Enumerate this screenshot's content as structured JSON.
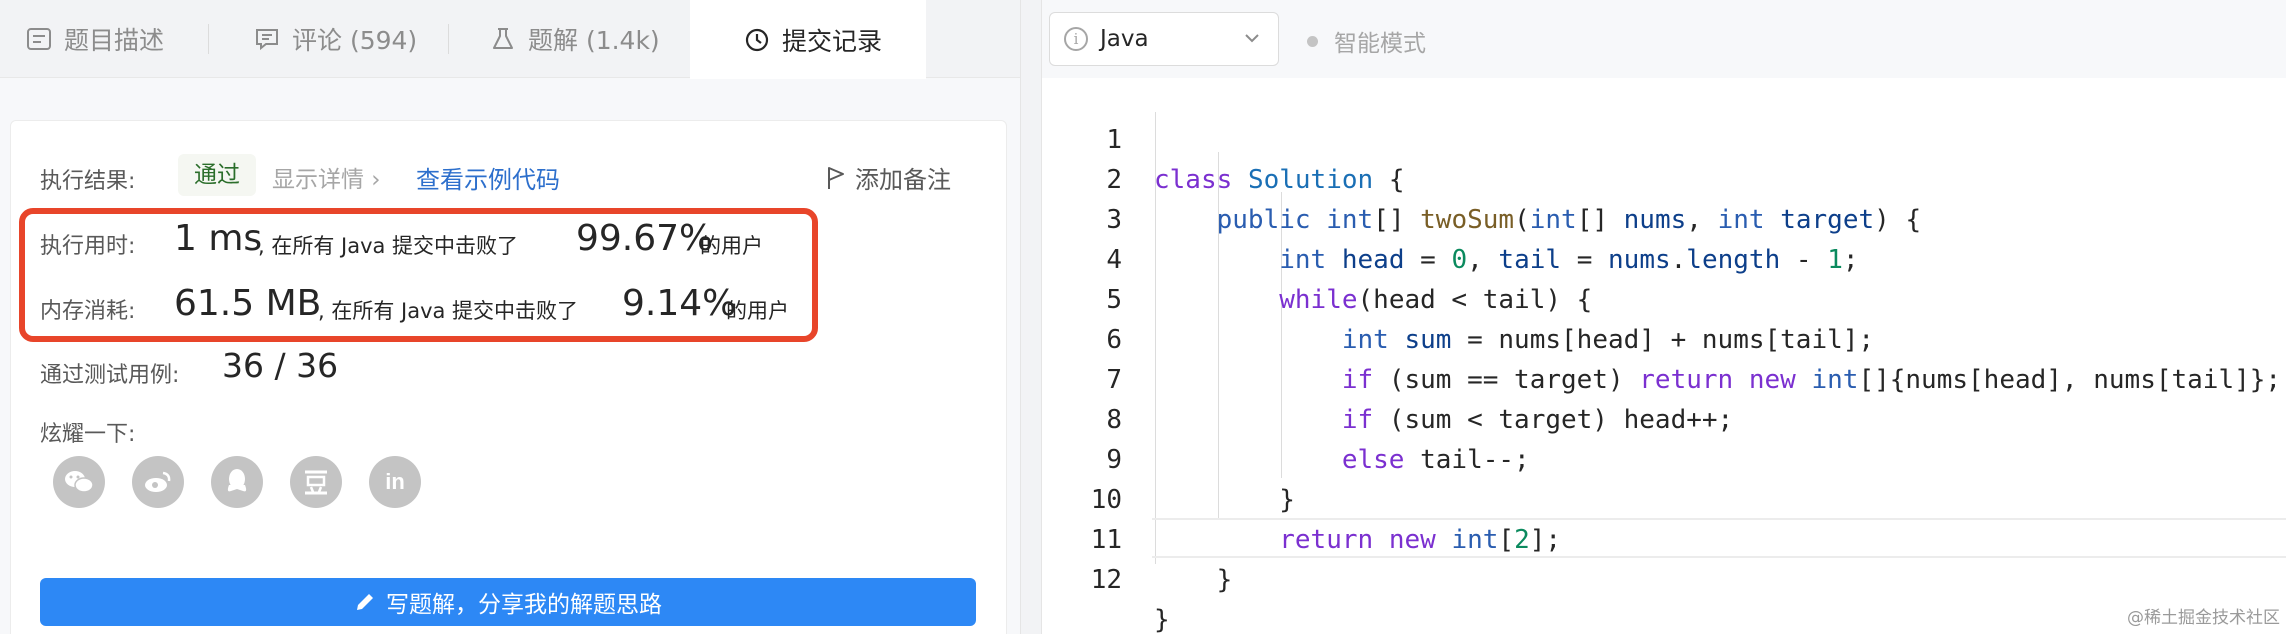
{
  "tabs": [
    {
      "label": "题目描述",
      "icon": "description-icon"
    },
    {
      "label": "评论 (594)",
      "icon": "comment-icon"
    },
    {
      "label": "题解 (1.4k)",
      "icon": "flask-icon"
    },
    {
      "label": "提交记录",
      "icon": "clock-icon",
      "active": true
    }
  ],
  "result": {
    "label": "执行结果:",
    "status": "通过",
    "details": "显示详情 ›",
    "sample_code": "查看示例代码",
    "add_note": "添加备注"
  },
  "runtime": {
    "label": "执行用时:",
    "value": "1 ms",
    "mid_text": ", 在所有 Java 提交中击败了",
    "percent": "99.67%",
    "suffix": "的用户"
  },
  "memory": {
    "label": "内存消耗:",
    "value": "61.5 MB",
    "mid_text": ", 在所有 Java 提交中击败了",
    "percent": "9.14%",
    "suffix": "的用户"
  },
  "tests": {
    "label": "通过测试用例:",
    "value": "36 / 36"
  },
  "share": {
    "label": "炫耀一下:",
    "icons": [
      "wechat-icon",
      "weibo-icon",
      "qq-icon",
      "douban-icon",
      "linkedin-icon"
    ]
  },
  "write_button": "写题解，分享我的解题思路",
  "editor": {
    "language": "Java",
    "smart_mode": "智能模式",
    "line_numbers": [
      "1",
      "2",
      "3",
      "4",
      "5",
      "6",
      "7",
      "8",
      "9",
      "10",
      "11",
      "12"
    ]
  },
  "watermark": "@稀土掘金技术社区",
  "colors": {
    "highlight_border": "#e8452a",
    "primary_button": "#2d88f5",
    "link": "#2d6fcc",
    "keyword": "#7b30d0",
    "type": "#2a5db0"
  }
}
